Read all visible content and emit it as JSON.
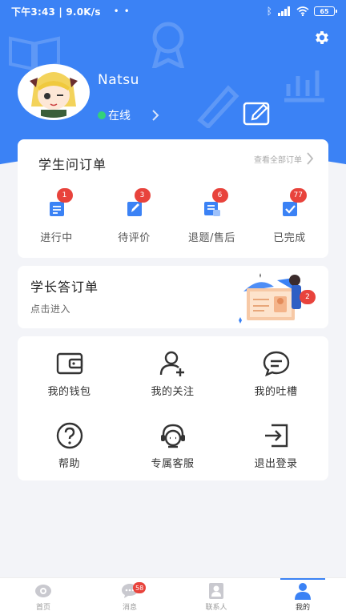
{
  "status_bar": {
    "time": "下午3:43 | 9.0K/s",
    "dots": "• •",
    "battery": "65"
  },
  "profile": {
    "username": "Natsu",
    "status": "在线"
  },
  "student_orders": {
    "title": "学生问订单",
    "view_all": "查看全部订单",
    "items": [
      {
        "label": "进行中",
        "badge": "1"
      },
      {
        "label": "待评价",
        "badge": "3"
      },
      {
        "label": "退题/售后",
        "badge": "6"
      },
      {
        "label": "已完成",
        "badge": "77"
      }
    ]
  },
  "senior_orders": {
    "title": "学长答订单",
    "subtitle": "点击进入",
    "badge": "2"
  },
  "menu": {
    "items": [
      {
        "label": "我的钱包",
        "icon": "wallet-icon"
      },
      {
        "label": "我的关注",
        "icon": "follow-user-icon"
      },
      {
        "label": "我的吐槽",
        "icon": "chat-bubble-icon"
      },
      {
        "label": "帮助",
        "icon": "help-icon"
      },
      {
        "label": "专属客服",
        "icon": "headset-icon"
      },
      {
        "label": "退出登录",
        "icon": "logout-icon"
      }
    ]
  },
  "tabbar": {
    "items": [
      {
        "label": "首页"
      },
      {
        "label": "消息",
        "badge": "58"
      },
      {
        "label": "联系人"
      },
      {
        "label": "我的"
      }
    ]
  },
  "colors": {
    "primary": "#3b82f5",
    "badge": "#e8433c",
    "online": "#33d17a"
  }
}
